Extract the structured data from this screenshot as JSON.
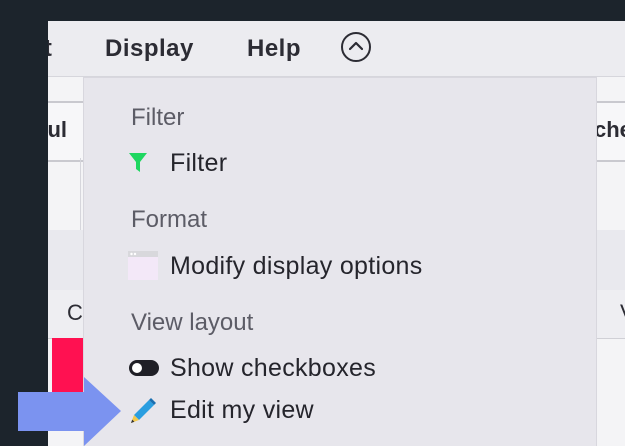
{
  "menubar": {
    "items": [
      {
        "label": "rt"
      },
      {
        "label": "Display"
      },
      {
        "label": "Help"
      }
    ],
    "collapse_icon": "chevron-up-circle-icon"
  },
  "background_table": {
    "header_left": "dul",
    "header_right": "che",
    "col_left": "C",
    "col_right": "V"
  },
  "dropdown": {
    "sections": [
      {
        "title": "Filter",
        "options": [
          {
            "label": "Filter",
            "icon": "filter-icon"
          }
        ]
      },
      {
        "title": "Format",
        "options": [
          {
            "label": "Modify display options",
            "icon": "window-icon"
          }
        ]
      },
      {
        "title": "View layout",
        "options": [
          {
            "label": "Show checkboxes",
            "icon": "toggle-icon"
          },
          {
            "label": "Edit my view",
            "icon": "pencil-icon"
          }
        ]
      }
    ]
  },
  "colors": {
    "filter_icon": "#1ed760",
    "pencil_icon": "#2a9ee0",
    "arrow": "#7b93f0",
    "accent_bar": "#ff1151"
  }
}
